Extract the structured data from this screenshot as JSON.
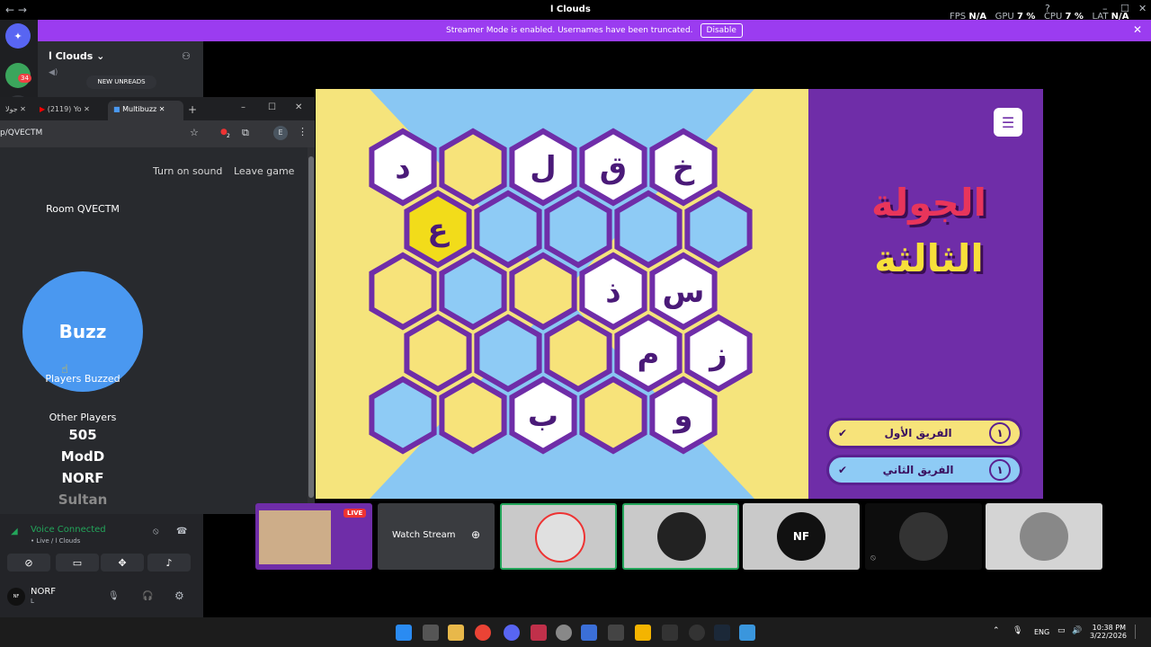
{
  "topbar": {
    "title": "ا Clouds",
    "fps_label": "FPS",
    "fps": "N/A",
    "gpu_label": "GPU",
    "gpu": "7 %",
    "cpu_label": "CPU",
    "cpu": "7 %",
    "lat_label": "LAT",
    "lat": "N/A"
  },
  "banner": {
    "text": "Streamer Mode is enabled. Usernames have been truncated.",
    "button": "Disable"
  },
  "rail": {
    "badge": "34"
  },
  "channel": {
    "server": "ا Clouds",
    "new_unreads": "NEW UNREADS"
  },
  "browser": {
    "tabs": [
      {
        "label": "جولا"
      },
      {
        "label": "(2119) Yo"
      },
      {
        "label": "Multibuzz"
      }
    ],
    "url": "p/QVECTM",
    "ext_badge": "2",
    "profile": "E"
  },
  "buzz": {
    "turn_on_sound": "Turn on sound",
    "leave_game": "Leave game",
    "room": "Room QVECTM",
    "button": "Buzz",
    "players_buzzed": "Players Buzzed",
    "other_players": "Other Players",
    "players": [
      "505",
      "ModD",
      "NORF",
      "Sultan"
    ]
  },
  "voice": {
    "status": "Voice Connected",
    "sub": "• Live / ا Clouds",
    "user": "NORF",
    "user_sub": "L",
    "avatar": "NF"
  },
  "game": {
    "round_line1": "الجولة",
    "round_line2": "الثالثة",
    "team1": "الفريق الأول",
    "team2": "الفريق الثاني",
    "team1_score": "١",
    "team2_score": "١",
    "letters": [
      "د",
      "",
      "ل",
      "ق",
      "خ",
      "ع",
      "",
      "",
      "",
      "",
      "",
      "",
      "",
      "ذ",
      "س",
      "",
      "",
      "",
      "م",
      "ز",
      "",
      "",
      "ب",
      "",
      "و"
    ]
  },
  "stream_tiles": {
    "live_badge": "LIVE",
    "watch": "Watch Stream",
    "avatar": "NF"
  },
  "taskbar": {
    "lang": "ENG",
    "time": "10:38 PM",
    "date": "3/22/2026"
  },
  "colors": {
    "accent": "#9b3cf0",
    "hex_yellow": "#f7e37a",
    "hex_blue": "#8ecbf5",
    "hex_purple": "#6f2da8",
    "buzz_blue": "#4a98f0"
  }
}
